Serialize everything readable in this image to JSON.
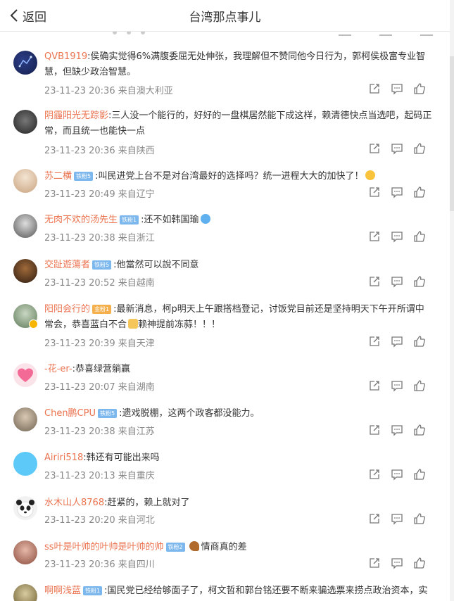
{
  "header": {
    "back_label": "返回",
    "title": "台湾那点事儿"
  },
  "icons": {
    "back": "chevron-left-icon",
    "share": "share-icon",
    "reply": "comment-icon",
    "like": "thumb-up-icon"
  },
  "colors": {
    "username": "#eb7350",
    "meta": "#888888",
    "badge_blue": "#7cb7ee",
    "badge_gold": "#f5b04d"
  },
  "comments": [
    {
      "user": "QVB1919",
      "text": ":侯确实觉得6%满腹委屈无处伸张，我理解但不赞同他今日行为，郭柯侯极富专业智",
      "text2": "慧，但缺少政治智慧。",
      "badge": "",
      "meta": "23-11-23 20:36 来自澳大利亚"
    },
    {
      "user": "阴霾阳光无踪影",
      "text": ":三人没一个能行的，好好的一盘棋居然能下成这样，赖清德快点当选吧，起码正",
      "text2": "常，而且统一也能快一点",
      "badge": "",
      "meta": "23-11-23 20:36 来自陕西"
    },
    {
      "user": "苏二横",
      "text": ":叫民进党上台不是对台湾最好的选择吗？统一进程大大的加快了！",
      "text2": "",
      "badge": "铁粉5",
      "meta": "23-11-23 20:49 来自辽宁"
    },
    {
      "user": "无肉不欢的汤先生",
      "text": ":还不如韩国瑜",
      "text2": "",
      "badge": "铁粉1",
      "meta": "23-11-23 20:38 来自浙江"
    },
    {
      "user": "交趾遊蕩者",
      "text": ":他當然可以說不同意",
      "text2": "",
      "badge": "铁粉5",
      "meta": "23-11-23 20:52 来自越南"
    },
    {
      "user": "阳阳会行的",
      "text": ":最新消息，柯p明天上午跟搭档登记，讨饭党目前还是坚持明天下午开所谓中",
      "text2": "常会，恭喜蓝白不合",
      "text3": "赖神提前冻蒜！！！",
      "badge": "金粉1",
      "meta": "23-11-23 20:39 来自天津"
    },
    {
      "user": "-花-er-",
      "text": ":恭喜绿营躺赢",
      "text2": "",
      "badge": "",
      "meta": "23-11-23 20:07 来自湖南"
    },
    {
      "user": "Chen鹏CPU",
      "text": ":遗戏脱棚，这两个政客都没能力。",
      "text2": "",
      "badge": "铁粉5",
      "meta": "23-11-23 20:38 来自江苏"
    },
    {
      "user": "Airiri518",
      "text": ":韩还有可能出来吗",
      "text2": "",
      "badge": "",
      "meta": "23-11-23 20:13 来自重庆"
    },
    {
      "user": "水木山人8768",
      "text": ":赶紧的，赖上就对了",
      "text2": "",
      "badge": "",
      "meta": "23-11-23 20:20 来自河北"
    },
    {
      "user": "ss叶是叶帅的叶帅是叶帅的帅",
      "text": "情商真的差",
      "text2": "",
      "badge": "铁粉2",
      "meta": "23-11-23 20:36 来自四川"
    },
    {
      "user": "啊啊浅蓝",
      "text": ":国民党已经给够面子了，柯文哲和郭台铭还要不断来骗选票来捞点政治资本，实",
      "text2": "",
      "badge": "铁粉1",
      "meta": ""
    }
  ]
}
